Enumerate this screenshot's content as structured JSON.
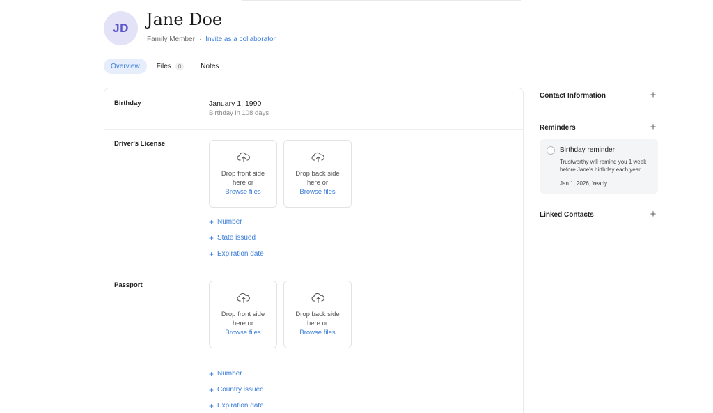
{
  "profile": {
    "initials": "JD",
    "name": "Jane Doe",
    "role": "Family Member",
    "separator": "·",
    "invite_label": "Invite as a collaborator"
  },
  "tabs": [
    {
      "label": "Overview",
      "active": true
    },
    {
      "label": "Files",
      "count": "0"
    },
    {
      "label": "Notes"
    }
  ],
  "birthday": {
    "label": "Birthday",
    "date": "January 1, 1990",
    "countdown": "Birthday in 108 days"
  },
  "drivers_license": {
    "label": "Driver's License",
    "front": {
      "text1": "Drop front side",
      "text2": "here or",
      "browse": "Browse files"
    },
    "back": {
      "text1": "Drop back side",
      "text2": "here or",
      "browse": "Browse files"
    },
    "fields": [
      "Number",
      "State issued",
      "Expiration date"
    ]
  },
  "passport": {
    "label": "Passport",
    "front": {
      "text1": "Drop front side",
      "text2": "here or",
      "browse": "Browse files"
    },
    "back": {
      "text1": "Drop back side",
      "text2": "here or",
      "browse": "Browse files"
    },
    "fields": [
      "Number",
      "Country issued",
      "Expiration date"
    ]
  },
  "sidebar": {
    "contact_information": "Contact Information",
    "reminders": "Reminders",
    "linked_contacts": "Linked Contacts",
    "add_symbol": "+"
  },
  "reminder": {
    "title": "Birthday reminder",
    "description": "Trustworthy will remind you 1 week before Jane's birthday each year.",
    "schedule": "Jan 1, 2026, Yearly"
  },
  "colors": {
    "accent": "#3b7dd8",
    "avatar_bg": "#e4e2f7",
    "avatar_text": "#5a56c9",
    "active_tab_bg": "#e6eefb"
  }
}
